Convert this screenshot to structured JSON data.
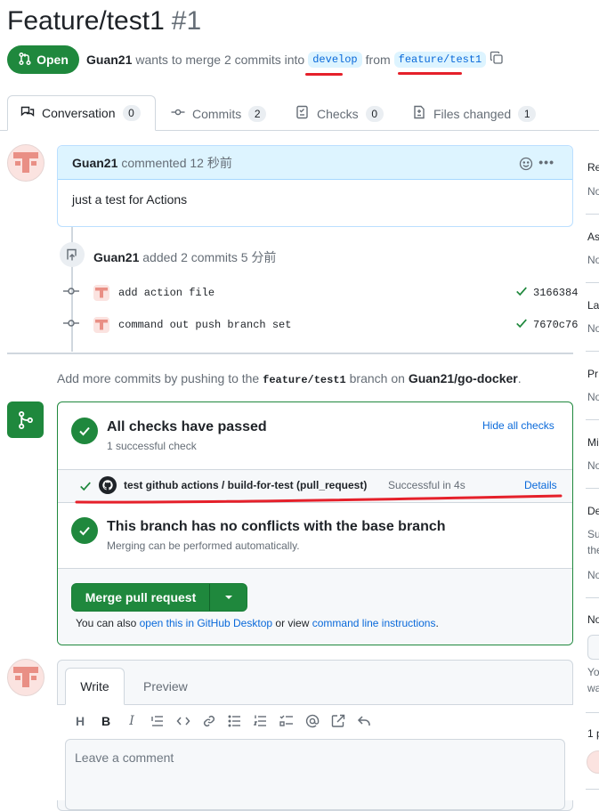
{
  "title": {
    "text": "Feature/test1",
    "number": "#1"
  },
  "header": {
    "state": "Open",
    "author": "Guan21",
    "merge_text_1": "wants to merge 2 commits into",
    "base_branch": "develop",
    "merge_text_2": "from",
    "head_branch": "feature/test1"
  },
  "tabs": [
    {
      "label": "Conversation",
      "count": "0"
    },
    {
      "label": "Commits",
      "count": "2"
    },
    {
      "label": "Checks",
      "count": "0"
    },
    {
      "label": "Files changed",
      "count": "1"
    }
  ],
  "comment": {
    "author": "Guan21",
    "action": "commented 12 秒前",
    "body": "just a test for Actions"
  },
  "commits_event": {
    "author": "Guan21",
    "action": "added 2 commits 5 分前",
    "items": [
      {
        "message": "add action file",
        "sha": "3166384"
      },
      {
        "message": "command out push branch set",
        "sha": "7670c76"
      }
    ]
  },
  "push_hint": {
    "pre": "Add more commits by pushing to the",
    "branch": "feature/test1",
    "mid": "branch on",
    "repo": "Guan21/go-docker",
    "post": "."
  },
  "checks": {
    "title": "All checks have passed",
    "subtitle": "1 successful check",
    "hide_link": "Hide all checks",
    "check_name": "test github actions / build-for-test (pull_request)",
    "check_status": "Successful in 4s",
    "details": "Details"
  },
  "conflicts": {
    "title": "This branch has no conflicts with the base branch",
    "subtitle": "Merging can be performed automatically."
  },
  "merge": {
    "button": "Merge pull request",
    "note_pre": "You can also",
    "note_link1": "open this in GitHub Desktop",
    "note_mid": "or view",
    "note_link2": "command line instructions",
    "note_post": "."
  },
  "editor": {
    "tab_write": "Write",
    "tab_preview": "Preview",
    "placeholder": "Leave a comment"
  },
  "sidebar_fragments": [
    "Re",
    "No",
    "As",
    "No",
    "La",
    "No",
    "Pr",
    "No",
    "Mi",
    "No",
    "De",
    "Su",
    "the",
    "No",
    "No",
    "Yo",
    "wa",
    "1 p"
  ],
  "colors": {
    "green": "#1f883d",
    "blue": "#0969da",
    "annotation_red": "#e5202a"
  }
}
